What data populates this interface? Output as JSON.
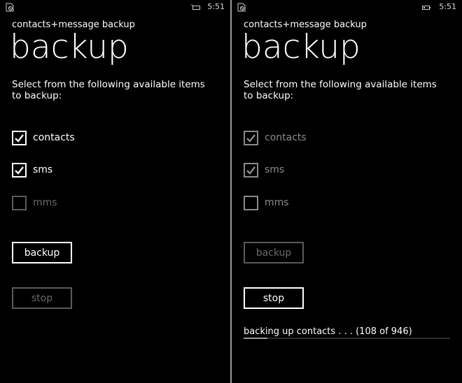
{
  "screens": [
    {
      "status": {
        "time": "5:51",
        "left_icon": "notification-icon",
        "right_icon": "battery-saver-icon"
      },
      "app_title": "contacts+message backup",
      "page_title": "backup",
      "instructions": "Select from the following available items to backup:",
      "items": [
        {
          "label": "contacts",
          "checked": true,
          "state": "enabled"
        },
        {
          "label": "sms",
          "checked": true,
          "state": "enabled"
        },
        {
          "label": "mms",
          "checked": false,
          "state": "disabled"
        }
      ],
      "buttons": {
        "backup": {
          "label": "backup",
          "state": "enabled"
        },
        "stop": {
          "label": "stop",
          "state": "disabled"
        }
      }
    },
    {
      "status": {
        "time": "5:51",
        "left_icon": "notification-icon",
        "right_icon": "battery-icon"
      },
      "app_title": "contacts+message backup",
      "page_title": "backup",
      "instructions": "Select from the following available items to backup:",
      "items": [
        {
          "label": "contacts",
          "checked": true,
          "state": "dimmed"
        },
        {
          "label": "sms",
          "checked": true,
          "state": "dimmed"
        },
        {
          "label": "mms",
          "checked": false,
          "state": "dimmed"
        }
      ],
      "buttons": {
        "backup": {
          "label": "backup",
          "state": "disabled"
        },
        "stop": {
          "label": "stop",
          "state": "enabled"
        }
      },
      "progress": {
        "text": "backing up contacts . . . (108 of 946)",
        "current": 108,
        "total": 946
      }
    }
  ]
}
